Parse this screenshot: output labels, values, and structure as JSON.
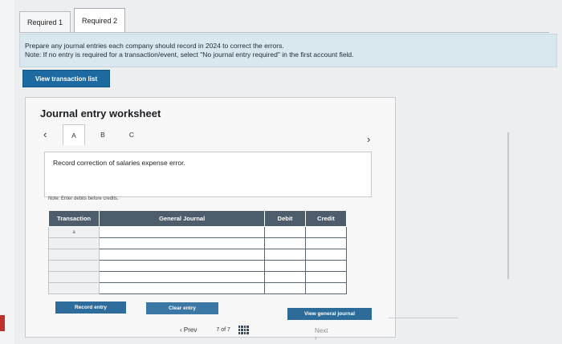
{
  "tabs": [
    {
      "label": "Required 1",
      "active": false
    },
    {
      "label": "Required 2",
      "active": true
    }
  ],
  "instructions": {
    "line1": "Prepare any journal entries each company should record in 2024 to correct the errors.",
    "line2": "Note: If no entry is required for a transaction/event, select \"No journal entry required\" in the first account field."
  },
  "view_transaction_button": "View transaction list",
  "worksheet": {
    "title": "Journal entry worksheet",
    "tabs": [
      "A",
      "B",
      "C"
    ],
    "active_tab": "A",
    "description": "Record correction of salaries expense error.",
    "note": "Note: Enter debits before credits.",
    "table": {
      "headers": [
        "Transaction",
        "General Journal",
        "Debit",
        "Credit"
      ],
      "rows": [
        [
          "a",
          "",
          "",
          ""
        ],
        [
          "",
          "",
          "",
          ""
        ],
        [
          "",
          "",
          "",
          ""
        ],
        [
          "",
          "",
          "",
          ""
        ],
        [
          "",
          "",
          "",
          ""
        ],
        [
          "",
          "",
          "",
          ""
        ]
      ]
    },
    "record_entry": "Record entry",
    "clear_entry": "Clear entry",
    "view_general_journal": "View general journal"
  },
  "pager": {
    "prev": "Prev",
    "current": "7",
    "of": "of",
    "total": "7",
    "next": "Next"
  },
  "colors": {
    "accent": "#1d6aa3",
    "table_header": "#4e5d6b",
    "instruction_bg": "#d9e7ef"
  }
}
